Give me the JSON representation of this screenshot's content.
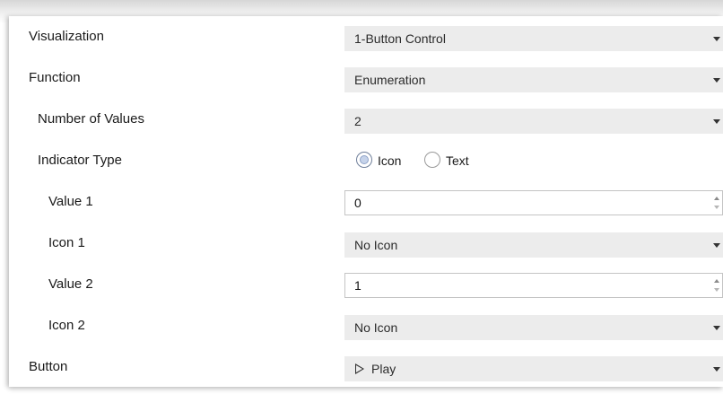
{
  "rows": {
    "visualization": {
      "label": "Visualization",
      "value": "1-Button Control"
    },
    "function": {
      "label": "Function",
      "value": "Enumeration"
    },
    "number_of_values": {
      "label": "Number of Values",
      "value": "2"
    },
    "indicator_type": {
      "label": "Indicator Type",
      "options": [
        {
          "label": "Icon",
          "selected": true
        },
        {
          "label": "Text",
          "selected": false
        }
      ]
    },
    "value1": {
      "label": "Value 1",
      "value": "0"
    },
    "icon1": {
      "label": "Icon 1",
      "value": "No Icon"
    },
    "value2": {
      "label": "Value 2",
      "value": "1"
    },
    "icon2": {
      "label": "Icon 2",
      "value": "No Icon"
    },
    "button": {
      "label": "Button",
      "value": "Play",
      "icon": "play-icon"
    }
  }
}
